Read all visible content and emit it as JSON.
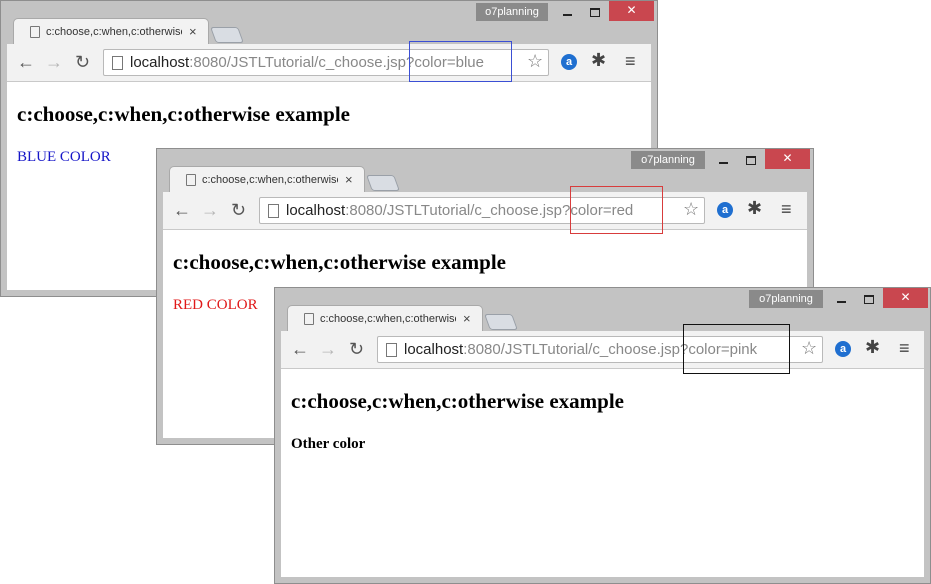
{
  "windows": [
    {
      "profile": "o7planning",
      "tab_title": "c:choose,c:when,c:otherwise example",
      "url_host": "localhost",
      "url_rest": ":8080/JSTLTutorial/c_choose.jsp?color=blue",
      "heading": "c:choose,c:when,c:otherwise example",
      "message": "BLUE COLOR",
      "highlight_color": "#3b4fd4"
    },
    {
      "profile": "o7planning",
      "tab_title": "c:choose,c:when,c:otherwise example",
      "url_host": "localhost",
      "url_rest": ":8080/JSTLTutorial/c_choose.jsp?color=red",
      "heading": "c:choose,c:when,c:otherwise example",
      "message": "RED COLOR",
      "highlight_color": "#d83c3c"
    },
    {
      "profile": "o7planning",
      "tab_title": "c:choose,c:when,c:otherwise example",
      "url_host": "localhost",
      "url_rest": ":8080/JSTLTutorial/c_choose.jsp?color=pink",
      "heading": "c:choose,c:when,c:otherwise example",
      "message": "Other color",
      "highlight_color": "#111111"
    }
  ],
  "icons": {
    "back": "arrow-left-icon",
    "forward": "arrow-right-icon",
    "reload": "reload-icon",
    "star": "star-icon",
    "menu": "hamburger-menu-icon"
  },
  "colors": {
    "blue_text": "#1515c8",
    "red_text": "#e01818",
    "close_button": "#c9474f"
  }
}
